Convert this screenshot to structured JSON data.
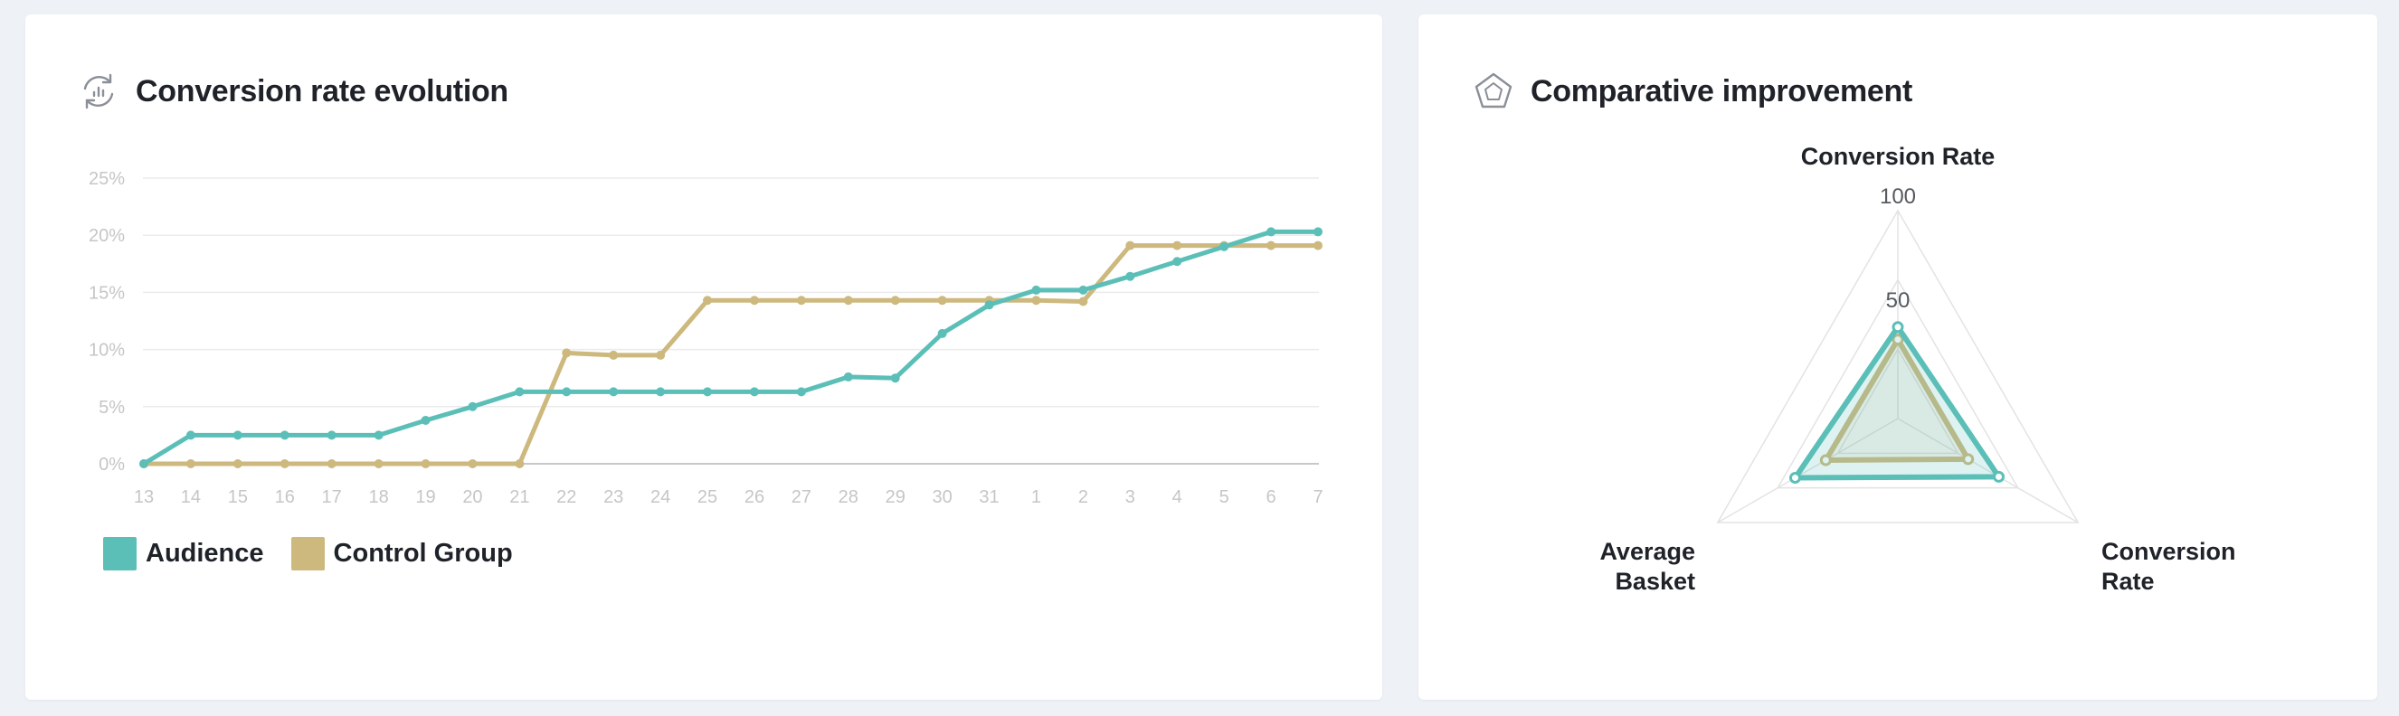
{
  "cards": {
    "left": {
      "title": "Conversion rate evolution",
      "icon": "refresh-chart-icon"
    },
    "right": {
      "title": "Comparative improvement",
      "icon": "pentagon-icon"
    }
  },
  "colors": {
    "audience": "#5bbfb8",
    "control": "#cdb87e",
    "grid": "#ebebeb",
    "axis_text": "#c6c6c6",
    "title": "#1f2228"
  },
  "chart_data": [
    {
      "type": "line",
      "title": "Conversion rate evolution",
      "x": [
        "13",
        "14",
        "15",
        "16",
        "17",
        "18",
        "19",
        "20",
        "21",
        "22",
        "23",
        "24",
        "25",
        "26",
        "27",
        "28",
        "29",
        "30",
        "31",
        "1",
        "2",
        "3",
        "4",
        "5",
        "6",
        "7"
      ],
      "yticks": [
        "0%",
        "5%",
        "10%",
        "15%",
        "20%",
        "25%"
      ],
      "ylim": [
        0,
        25
      ],
      "grid": true,
      "legend_position": "bottom-left",
      "series": [
        {
          "name": "Audience",
          "values": [
            0,
            2.5,
            2.5,
            2.5,
            2.5,
            2.5,
            3.8,
            5.0,
            6.3,
            6.3,
            6.3,
            6.3,
            6.3,
            6.3,
            6.3,
            7.6,
            7.5,
            11.4,
            13.9,
            15.2,
            15.2,
            16.4,
            17.7,
            19.0,
            20.3,
            20.3
          ]
        },
        {
          "name": "Control Group",
          "values": [
            0,
            0,
            0,
            0,
            0,
            0,
            0,
            0,
            0,
            9.7,
            9.5,
            9.5,
            14.3,
            14.3,
            14.3,
            14.3,
            14.3,
            14.3,
            14.3,
            14.3,
            14.2,
            19.1,
            19.1,
            19.1,
            19.1,
            19.1
          ]
        }
      ]
    },
    {
      "type": "radar",
      "title": "Comparative improvement",
      "axes": [
        "Conversion Rate",
        "Conversion Rate",
        "Average Basket"
      ],
      "axis_label_lines": [
        [
          "Conversion Rate"
        ],
        [
          "Conversion",
          "Rate"
        ],
        [
          "Average",
          "Basket"
        ]
      ],
      "rmax": 100,
      "rticks": [
        "50",
        "100"
      ],
      "series": [
        {
          "name": "Audience",
          "values": [
            44,
            56,
            57
          ]
        },
        {
          "name": "Control Group",
          "values": [
            38,
            39,
            40
          ]
        }
      ]
    }
  ]
}
